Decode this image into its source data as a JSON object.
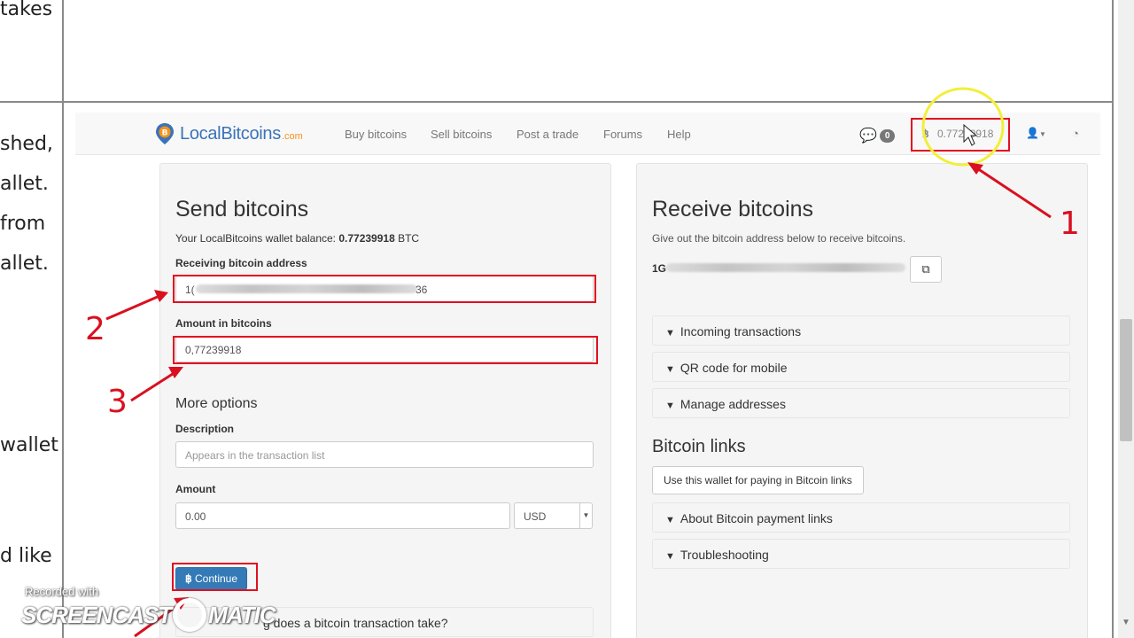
{
  "document": {
    "lines": [
      "takes",
      "shed,",
      "allet.",
      "from",
      "allet.",
      "wallet",
      "d like"
    ]
  },
  "navbar": {
    "brand": "LocalBitcoins",
    "brand_suffix": ".com",
    "links": [
      "Buy bitcoins",
      "Sell bitcoins",
      "Post a trade",
      "Forums",
      "Help"
    ],
    "messages_count": "0",
    "balance": "0.77239918"
  },
  "send": {
    "title": "Send bitcoins",
    "balance_prefix": "Your LocalBitcoins wallet balance: ",
    "balance_value": "0.77239918",
    "balance_unit": " BTC",
    "address_label": "Receiving bitcoin address",
    "address_start": "1(",
    "address_end": "36",
    "amount_btc_label": "Amount in bitcoins",
    "amount_btc_value": "0,77239918",
    "more_options": "More options",
    "description_label": "Description",
    "description_placeholder": "Appears in the transaction list",
    "amount_label": "Amount",
    "amount_value": "0.00",
    "currency": "USD",
    "continue_label": "Continue",
    "faq_text": "g does a bitcoin transaction take?"
  },
  "receive": {
    "title": "Receive bitcoins",
    "subtitle": "Give out the bitcoin address below to receive bitcoins.",
    "address_start": "1G",
    "accordion_1": [
      "Incoming transactions",
      "QR code for mobile",
      "Manage addresses"
    ],
    "links_title": "Bitcoin links",
    "links_button": "Use this wallet for paying in Bitcoin links",
    "accordion_2": [
      "About Bitcoin payment links",
      "Troubleshooting"
    ]
  },
  "annotations": [
    "1",
    "2",
    "3"
  ],
  "watermark": {
    "recorded": "Recorded with",
    "brand": "SCREENCAST",
    "brand_end": "MATIC"
  },
  "colors": {
    "annotation_red": "#d9101f",
    "brand_blue": "#3b73b9",
    "brand_orange": "#f7931a",
    "primary_button": "#337ab7",
    "highlight_yellow": "#f2ef3a"
  }
}
